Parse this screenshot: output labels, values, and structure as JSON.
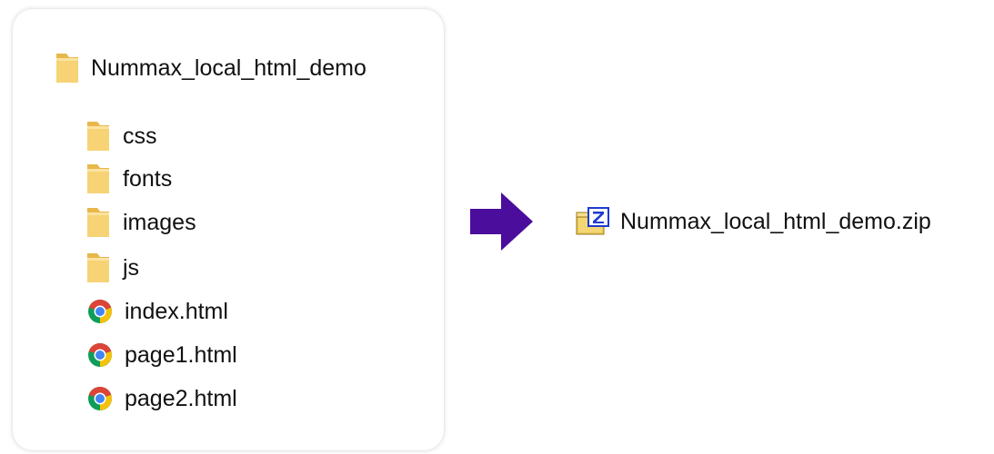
{
  "source_panel": {
    "root_folder": {
      "label": "Nummax_local_html_demo",
      "icon": "folder-icon"
    },
    "items": [
      {
        "label": "css",
        "icon": "folder-icon"
      },
      {
        "label": "fonts",
        "icon": "folder-icon"
      },
      {
        "label": "images",
        "icon": "folder-icon"
      },
      {
        "label": "js",
        "icon": "folder-icon"
      },
      {
        "label": "index.html",
        "icon": "chrome-icon"
      },
      {
        "label": "page1.html",
        "icon": "chrome-icon"
      },
      {
        "label": "page2.html",
        "icon": "chrome-icon"
      }
    ]
  },
  "arrow": {
    "icon": "right-arrow-icon",
    "color": "#4a0d9c"
  },
  "result": {
    "label": "Nummax_local_html_demo.zip",
    "icon": "zip-archive-icon",
    "badge_letter": "Z"
  },
  "colors": {
    "folder_fill": "#f5cd67",
    "folder_light": "#fbe08f",
    "chrome_red": "#db4437",
    "chrome_yellow": "#f4c20d",
    "chrome_green": "#0f9d58",
    "chrome_blue": "#4285f4",
    "zip_badge": "#1d3bd0"
  }
}
